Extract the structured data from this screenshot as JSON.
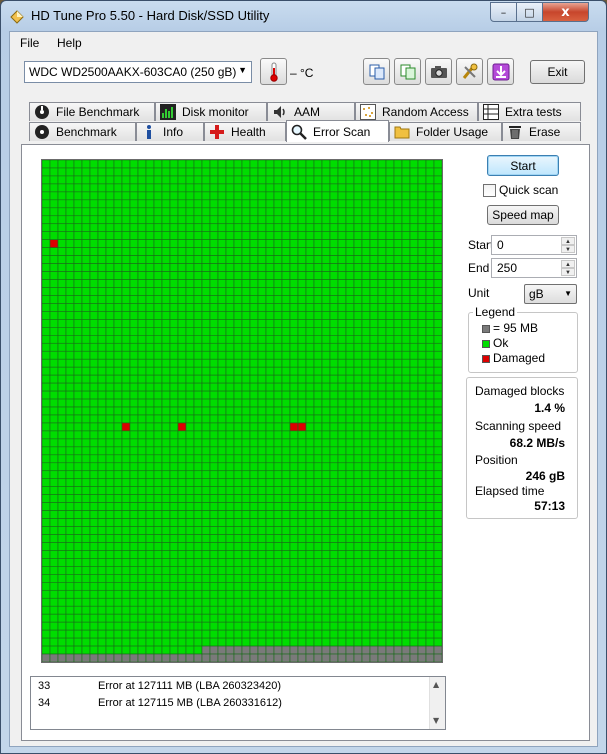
{
  "window": {
    "title": "HD Tune Pro 5.50 - Hard Disk/SSD Utility",
    "close_glyph": "x",
    "min_glyph": "–",
    "max_glyph": "□"
  },
  "menu": {
    "file": "File",
    "help": "Help"
  },
  "toolbar": {
    "drive": "WDC WD2500AAKX-603CA0 (250 gB)",
    "temperature": "– °C",
    "exit_label": "Exit"
  },
  "tabs": {
    "row1": [
      "File Benchmark",
      "Disk monitor",
      "AAM",
      "Random Access",
      "Extra tests"
    ],
    "row2": [
      "Benchmark",
      "Info",
      "Health",
      "Error Scan",
      "Folder Usage",
      "Erase"
    ],
    "active": "Error Scan"
  },
  "controls": {
    "start_button": "Start",
    "quick_scan": "Quick scan",
    "quick_scan_checked": false,
    "speed_map_button": "Speed map",
    "start_label": "Start",
    "start_value": "0",
    "end_label": "End",
    "end_value": "250",
    "unit_label": "Unit",
    "unit_value": "gB"
  },
  "legend": {
    "title": "Legend",
    "items": [
      {
        "label": "= 95 MB",
        "color": "#7a7a7a"
      },
      {
        "label": "Ok",
        "color": "#00dd00"
      },
      {
        "label": "Damaged",
        "color": "#dd0000"
      }
    ]
  },
  "stats": {
    "damaged_blocks_label": "Damaged blocks",
    "damaged_blocks_value": "1.4 %",
    "scanning_speed_label": "Scanning speed",
    "scanning_speed_value": "68.2 MB/s",
    "position_label": "Position",
    "position_value": "246 gB",
    "elapsed_time_label": "Elapsed time",
    "elapsed_time_value": "57:13"
  },
  "block_map": {
    "columns": 50,
    "rows": 63,
    "ok_color": "#00dd00",
    "damaged_color": "#dd0000",
    "unscanned_color": "#7a7a7a",
    "gridline_color": "#1a6b1a",
    "damaged_blocks": [
      [
        10,
        1
      ],
      [
        33,
        10
      ],
      [
        33,
        17
      ],
      [
        33,
        31
      ],
      [
        33,
        32
      ]
    ],
    "unscanned_from": {
      "row": 61,
      "col": 20
    }
  },
  "log": [
    {
      "num": "33",
      "text": "Error at 127111 MB (LBA 260323420)"
    },
    {
      "num": "34",
      "text": "Error at 127115 MB (LBA 260331612)"
    }
  ]
}
